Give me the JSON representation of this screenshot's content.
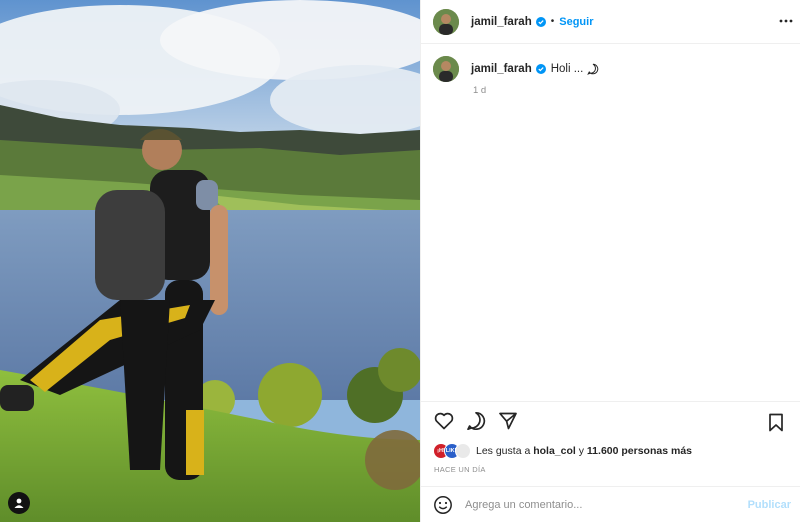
{
  "post": {
    "username": "jamil_farah",
    "follow_label": "Seguir",
    "separator": "•",
    "caption": "Holi ...",
    "time_ago": "1 d",
    "likes": {
      "prefix": "Les gusta a ",
      "user": "hola_col",
      "middle": " y ",
      "count": "11.600 personas más",
      "avatar_badges": [
        "¡H!",
        "LIKE",
        ""
      ]
    },
    "date_label": "HACE UN DÍA",
    "comment_placeholder": "Agrega un comentario...",
    "publish_label": "Publicar"
  },
  "icons": {
    "verified": "verified-badge-icon",
    "more": "more-options-icon",
    "comment_bubble": "speech-bubble-icon",
    "like": "heart-icon",
    "comment": "comment-icon",
    "share": "paper-plane-icon",
    "save": "bookmark-icon",
    "emoji": "smiley-icon",
    "tag": "user-tag-icon"
  },
  "colors": {
    "accent": "#0095f6",
    "verified": "#0095f6",
    "muted": "#8e8e8e",
    "publish_disabled": "#b2dffc",
    "border": "#efefef"
  }
}
